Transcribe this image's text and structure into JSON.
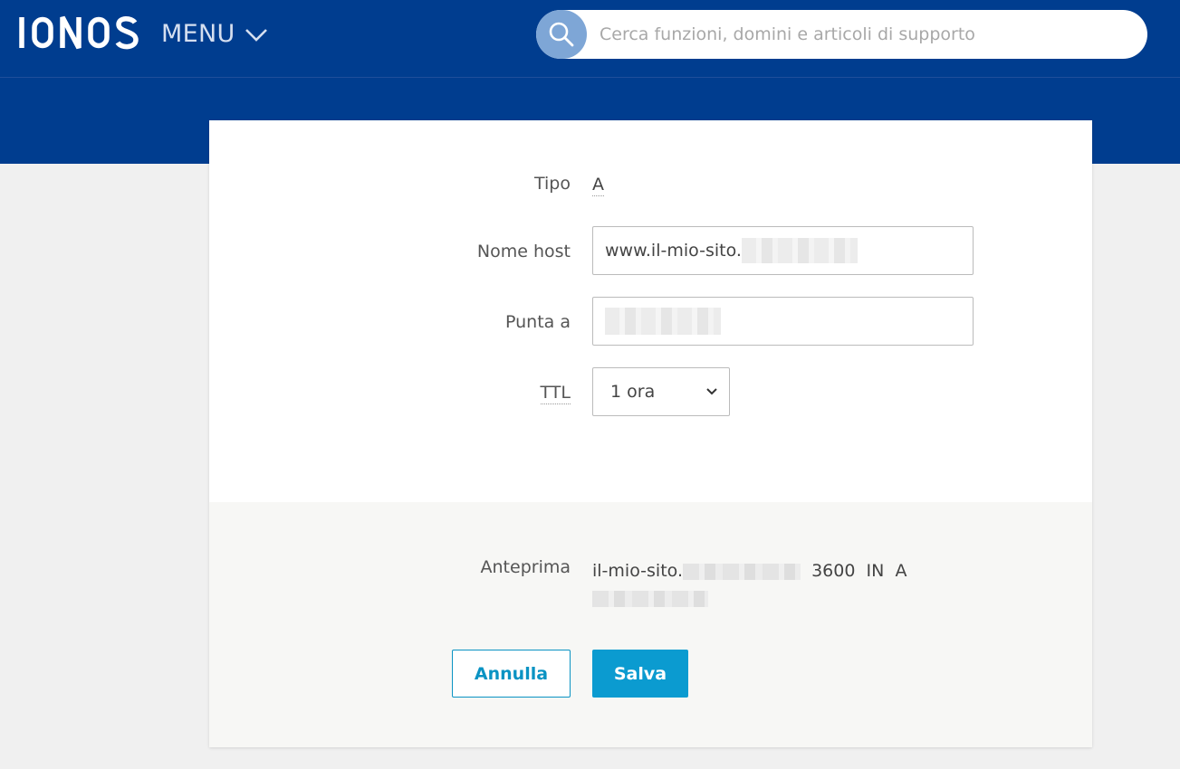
{
  "header": {
    "logo_text": "IONOS",
    "menu_label": "MENU",
    "search_placeholder": "Cerca funzioni, domini e articoli di supporto",
    "search_icon": "magnifier-icon",
    "menu_icon": "chevron-down-icon"
  },
  "form": {
    "tipo_label": "Tipo",
    "tipo_value": "A",
    "nome_host_label": "Nome host",
    "nome_host_value": "www.il-mio-sito.",
    "punta_a_label": "Punta a",
    "ttl_label": "TTL",
    "ttl_selected": "1 ora",
    "ttl_icon": "chevron-down-icon"
  },
  "preview": {
    "label": "Anteprima",
    "host": "il-mio-sito.",
    "ttl_seconds": "3600",
    "class": "IN",
    "type": "A"
  },
  "actions": {
    "cancel_label": "Annulla",
    "save_label": "Salva"
  },
  "colors": {
    "header_bg": "#003d8f",
    "accent": "#0b9bd0",
    "search_button_bg": "#7ea6d6"
  }
}
